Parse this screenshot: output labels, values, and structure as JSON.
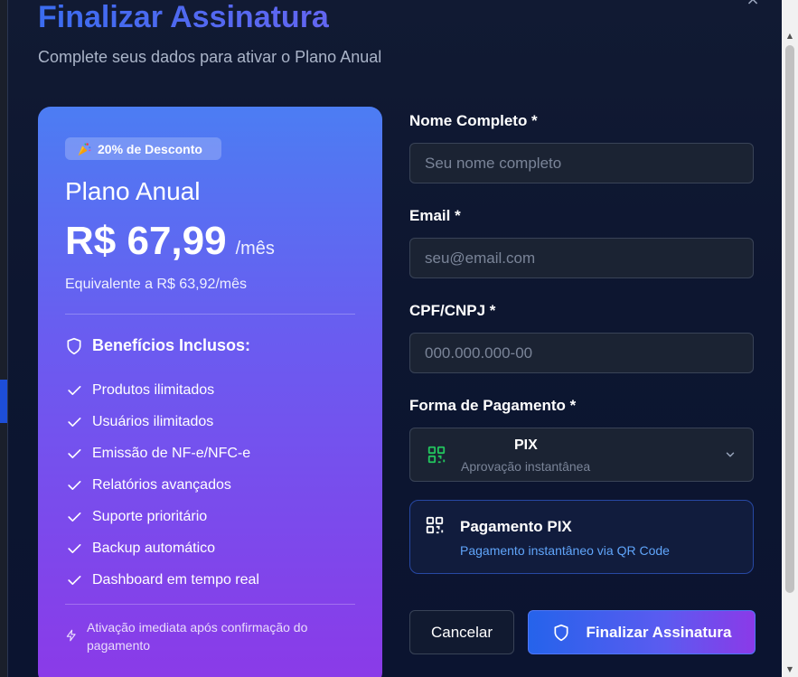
{
  "modal": {
    "title": "Finalizar Assinatura",
    "subtitle": "Complete seus dados para ativar o Plano Anual",
    "close_icon": "close-icon"
  },
  "plan": {
    "badge": "20% de Desconto",
    "badge_icon": "party-popper-icon",
    "name": "Plano Anual",
    "price": "R$ 67,99",
    "period": "/mês",
    "equivalent": "Equivalente a R$ 63,92/mês",
    "benefits_title": "Benefícios Inclusos:",
    "benefits": [
      "Produtos ilimitados",
      "Usuários ilimitados",
      "Emissão de NF-e/NFC-e",
      "Relatórios avançados",
      "Suporte prioritário",
      "Backup automático",
      "Dashboard em tempo real"
    ],
    "activation_note": "Ativação imediata após confirmação do pagamento"
  },
  "form": {
    "name_label": "Nome Completo *",
    "name_placeholder": "Seu nome completo",
    "name_value": "",
    "email_label": "Email *",
    "email_placeholder": "seu@email.com",
    "email_value": "",
    "cpf_label": "CPF/CNPJ *",
    "cpf_placeholder": "000.000.000-00",
    "cpf_value": "",
    "payment_label": "Forma de Pagamento *",
    "payment_selected": "PIX",
    "payment_selected_sub": "Aprovação instantânea"
  },
  "pix_info": {
    "title": "Pagamento PIX",
    "subtitle": "Pagamento instantâneo via QR Code"
  },
  "actions": {
    "cancel": "Cancelar",
    "submit": "Finalizar Assinatura"
  },
  "colors": {
    "accent_blue": "#2563eb",
    "accent_purple": "#8b3ae8",
    "pix_green": "#22c55e",
    "link_blue": "#60a5fa"
  }
}
